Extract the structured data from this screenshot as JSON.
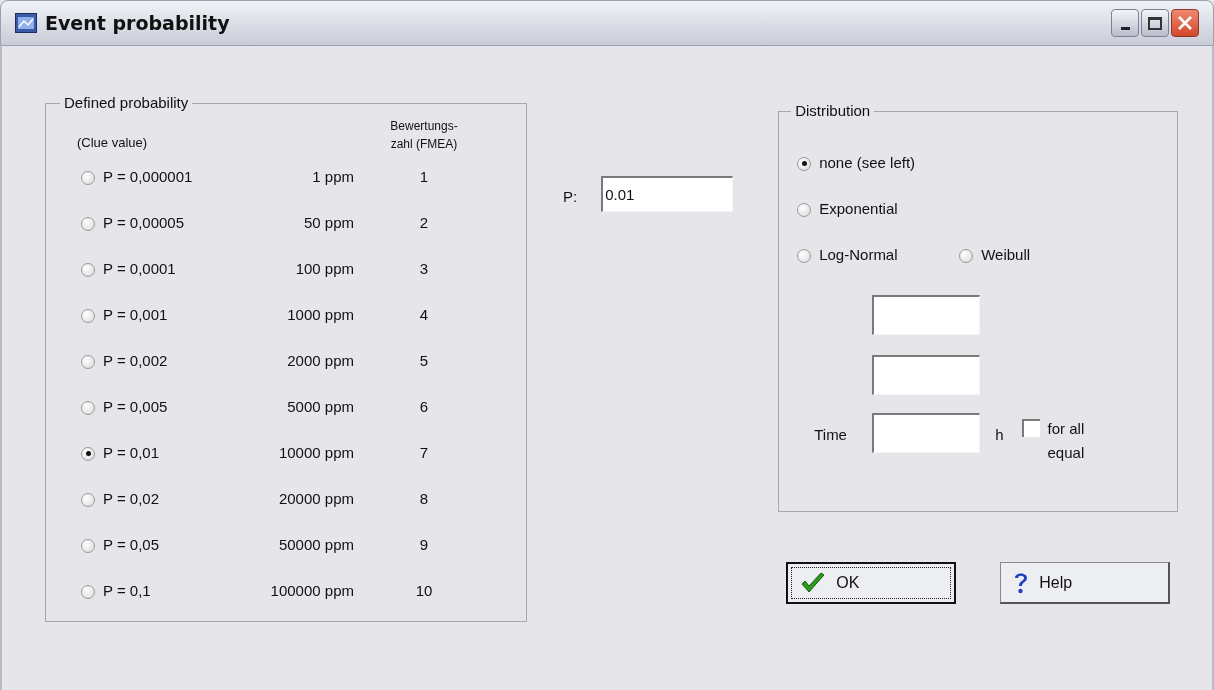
{
  "window": {
    "title": "Event probability"
  },
  "defined_probability": {
    "title": "Defined probability",
    "header_value": "(Clue value)",
    "header_score": "Bewertungs-zahl (FMEA)",
    "options": [
      {
        "label": "P = 0,000001",
        "ppm": "1 ppm",
        "score": "1",
        "selected": false
      },
      {
        "label": "P = 0,00005",
        "ppm": "50 ppm",
        "score": "2",
        "selected": false
      },
      {
        "label": "P = 0,0001",
        "ppm": "100 ppm",
        "score": "3",
        "selected": false
      },
      {
        "label": "P = 0,001",
        "ppm": "1000 ppm",
        "score": "4",
        "selected": false
      },
      {
        "label": "P = 0,002",
        "ppm": "2000 ppm",
        "score": "5",
        "selected": false
      },
      {
        "label": "P = 0,005",
        "ppm": "5000 ppm",
        "score": "6",
        "selected": false
      },
      {
        "label": "P = 0,01",
        "ppm": "10000 ppm",
        "score": "7",
        "selected": true
      },
      {
        "label": "P = 0,02",
        "ppm": "20000 ppm",
        "score": "8",
        "selected": false
      },
      {
        "label": "P = 0,05",
        "ppm": "50000 ppm",
        "score": "9",
        "selected": false
      },
      {
        "label": "P = 0,1",
        "ppm": "100000 ppm",
        "score": "10",
        "selected": false
      }
    ]
  },
  "p_field": {
    "label": "P:",
    "value": "0.01"
  },
  "distribution": {
    "title": "Distribution",
    "rows": [
      [
        {
          "label": "none (see left)",
          "selected": true
        }
      ],
      [
        {
          "label": "Exponential",
          "selected": false
        }
      ],
      [
        {
          "label": "Log-Normal",
          "selected": false
        },
        {
          "label": "Weibull",
          "selected": false
        }
      ]
    ],
    "time": {
      "label": "Time",
      "unit": "h"
    },
    "checkbox": {
      "label": "for all equal",
      "checked": false
    }
  },
  "buttons": [
    {
      "label": "OK",
      "kind": "ok",
      "focused": true
    },
    {
      "label": "Help",
      "kind": "help",
      "focused": false
    }
  ]
}
